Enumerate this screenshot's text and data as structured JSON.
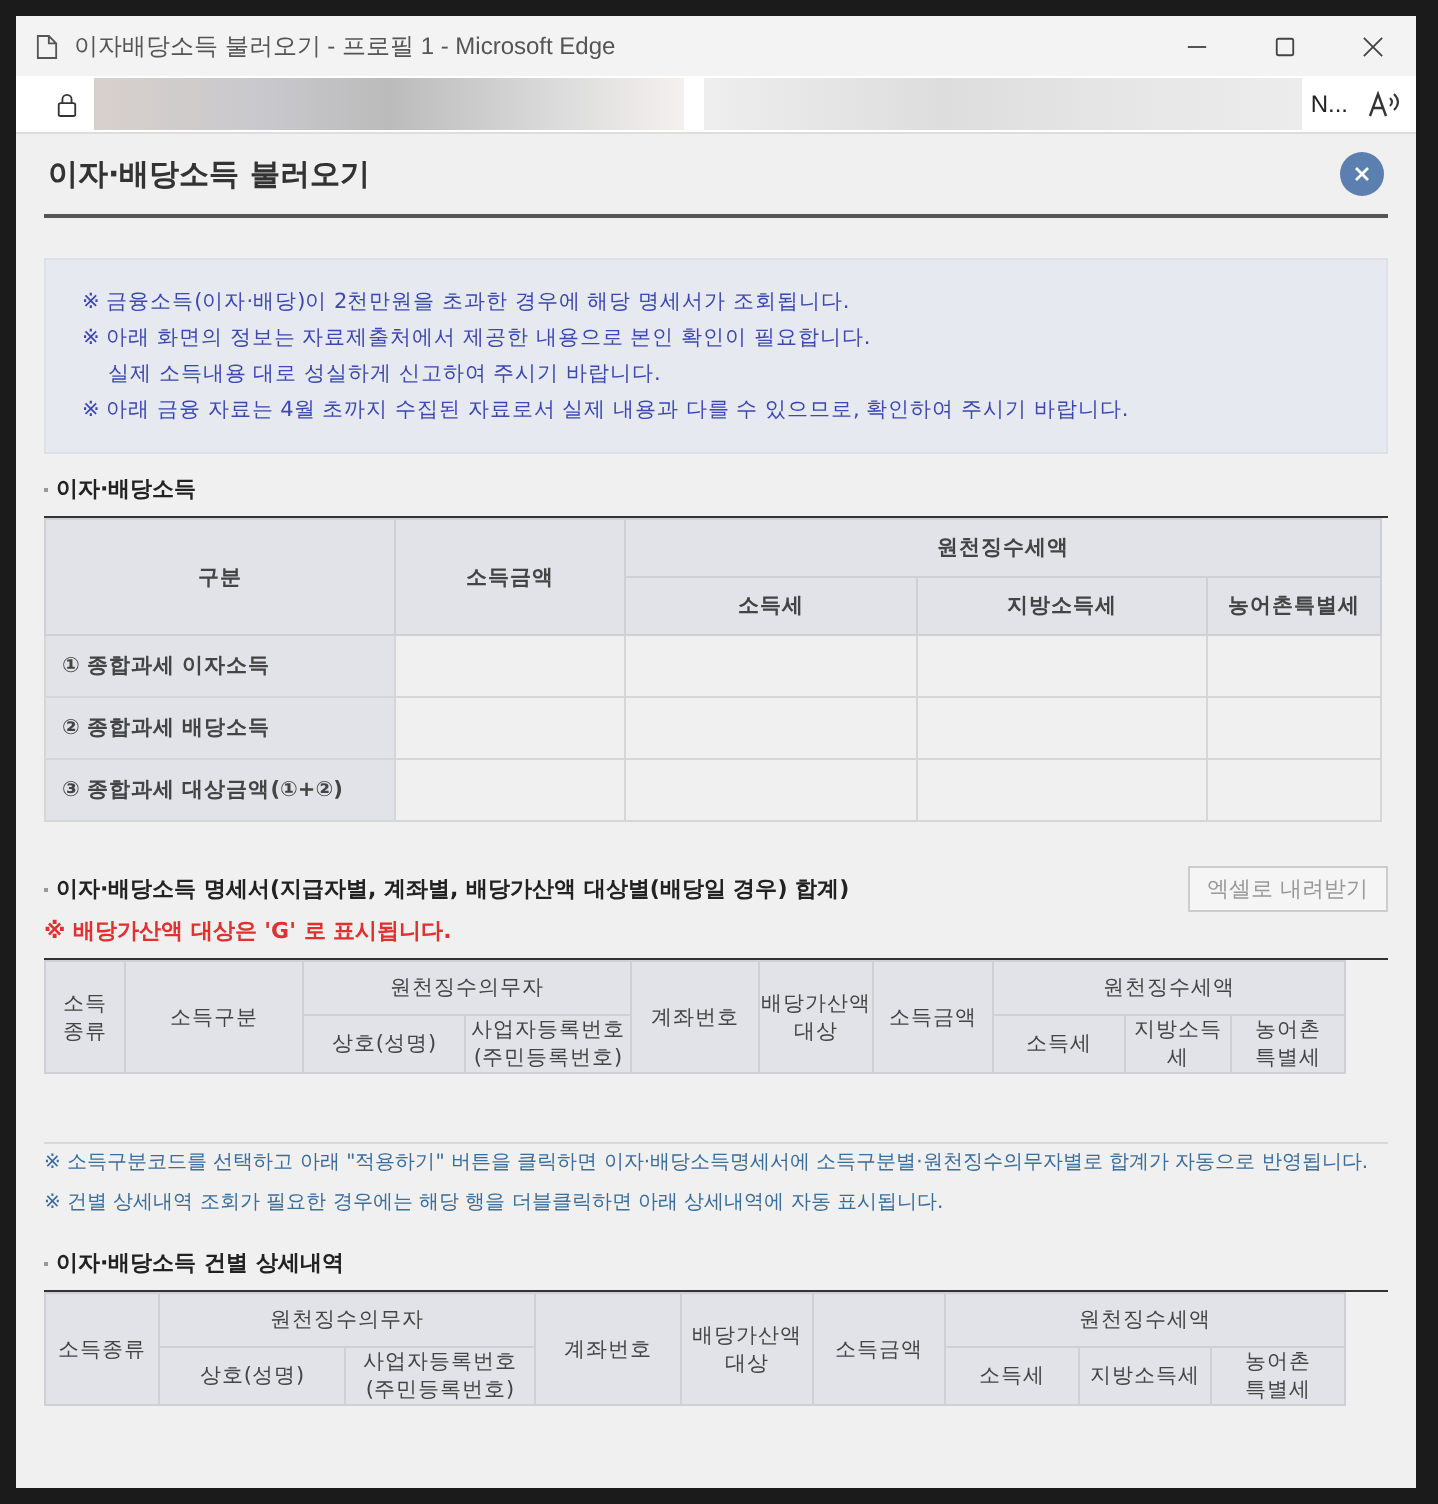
{
  "window": {
    "title": "이자배당소득 불러오기 - 프로필 1 - Microsoft Edge"
  },
  "address_bar": {
    "trailing_text": "N..."
  },
  "dialog": {
    "title": "이자·배당소득 불러오기"
  },
  "notice": [
    {
      "text": "※ 금융소득(이자·배당)이 2천만원을 초과한 경우에 해당 명세서가 조회됩니다.",
      "indent": false
    },
    {
      "text": "※ 아래 화면의 정보는 자료제출처에서 제공한 내용으로 본인 확인이 필요합니다.",
      "indent": false
    },
    {
      "text": "실제 소득내용 대로 성실하게 신고하여 주시기 바랍니다.",
      "indent": true
    },
    {
      "text": "※ 아래 금융 자료는 4월 초까지 수집된 자료로서 실제 내용과 다를 수 있으므로, 확인하여 주시기 바랍니다.",
      "indent": false
    }
  ],
  "sections": [
    {
      "title": "이자·배당소득",
      "table": {
        "columns": [
          {
            "label": "구분"
          },
          {
            "label": "소득금액"
          },
          {
            "label": "원천징수세액",
            "children": [
              {
                "label": "소득세"
              },
              {
                "label": "지방소득세"
              },
              {
                "label": "농어촌특별세"
              }
            ]
          }
        ],
        "rows": [
          {
            "label": "① 종합과세 이자소득"
          },
          {
            "label": "② 종합과세 배당소득"
          },
          {
            "label": "③ 종합과세 대상금액(①+②)"
          }
        ]
      }
    },
    {
      "title": "이자·배당소득 명세서(지급자별, 계좌별, 배당가산액 대상별(배당일 경우) 합계)",
      "button": "엑셀로 내려받기",
      "warning": "※ 배당가산액 대상은 'G' 로 표시됩니다.",
      "table": {
        "columns": [
          {
            "label": "소득\n종류"
          },
          {
            "label": "소득구분"
          },
          {
            "label": "원천징수의무자",
            "children": [
              {
                "label": "상호(성명)"
              },
              {
                "label": "사업자등록번호\n(주민등록번호)"
              }
            ]
          },
          {
            "label": "계좌번호"
          },
          {
            "label": "배당가산액\n대상"
          },
          {
            "label": "소득금액"
          },
          {
            "label": "원천징수세액",
            "children": [
              {
                "label": "소득세"
              },
              {
                "label": "지방소득세"
              },
              {
                "label": "농어촌\n특별세"
              }
            ]
          }
        ]
      },
      "notes": [
        "※ 소득구분코드를 선택하고 아래 \"적용하기\" 버튼을 클릭하면 이자·배당소득명세서에 소득구분별·원천징수의무자별로 합계가 자동으로 반영됩니다.",
        "※ 건별 상세내역 조회가 필요한 경우에는 해당 행을 더블클릭하면 아래 상세내역에 자동 표시됩니다."
      ]
    },
    {
      "title": "이자·배당소득 건별 상세내역",
      "table": {
        "columns": [
          {
            "label": "소득종류"
          },
          {
            "label": "원천징수의무자",
            "children": [
              {
                "label": "상호(성명)"
              },
              {
                "label": "사업자등록번호\n(주민등록번호)"
              }
            ]
          },
          {
            "label": "계좌번호"
          },
          {
            "label": "배당가산액\n대상"
          },
          {
            "label": "소득금액"
          },
          {
            "label": "원천징수세액",
            "children": [
              {
                "label": "소득세"
              },
              {
                "label": "지방소득세"
              },
              {
                "label": "농어촌\n특별세"
              }
            ]
          }
        ]
      }
    }
  ]
}
